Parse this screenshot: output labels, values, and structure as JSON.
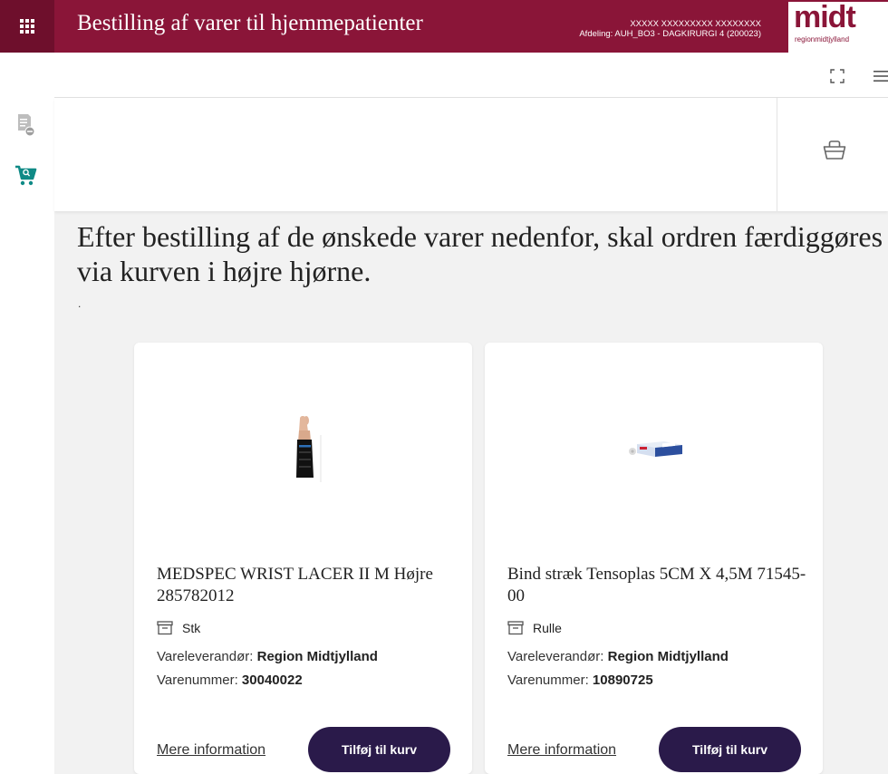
{
  "header": {
    "app_title": "Bestilling af varer til hjemmepatienter",
    "user_name": "XXXXX XXXXXXXXX XXXXXXXX",
    "department": "Afdeling: AUH_BO3 - DAGKIRURGI 4 (200023)",
    "logo_main": "midt",
    "logo_sub": "regionmidtjylland",
    "brand_color": "#8a1538"
  },
  "icons": {
    "apps": "grid-icon",
    "orders": "document-minus-icon",
    "shop": "cart-search-icon",
    "fullscreen": "fullscreen-icon",
    "menu": "hamburger-icon",
    "basket": "basket-icon",
    "unit": "package-icon"
  },
  "main": {
    "heading": "Efter bestilling af de ønskede varer nedenfor, skal ordren færdiggøres via kurven i højre hjørne.",
    "note": "."
  },
  "products": [
    {
      "title": "MEDSPEC WRIST LACER II M Højre 285782012",
      "unit": "Stk",
      "supplier_label": "Vareleverandør: ",
      "supplier": "Region Midtjylland",
      "itemno_label": "Varenummer: ",
      "itemno": "30040022",
      "more_label": "Mere information",
      "add_label": "Tilføj til kurv"
    },
    {
      "title": "Bind stræk Tensoplas 5CM X 4,5M 71545-00",
      "unit": "Rulle",
      "supplier_label": "Vareleverandør: ",
      "supplier": "Region Midtjylland",
      "itemno_label": "Varenummer: ",
      "itemno": "10890725",
      "more_label": "Mere information",
      "add_label": "Tilføj til kurv"
    }
  ],
  "colors": {
    "button_bg": "#2a1a4a",
    "shop_icon": "#0f8a86"
  }
}
